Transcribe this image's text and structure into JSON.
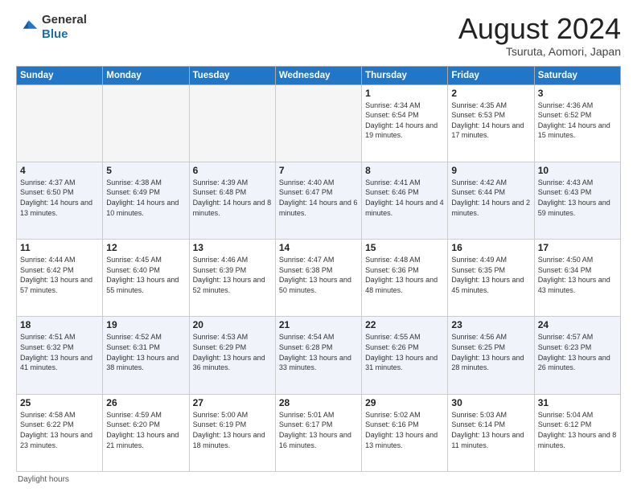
{
  "header": {
    "logo_line1": "General",
    "logo_line2": "Blue",
    "month_title": "August 2024",
    "location": "Tsuruta, Aomori, Japan"
  },
  "calendar": {
    "days_of_week": [
      "Sunday",
      "Monday",
      "Tuesday",
      "Wednesday",
      "Thursday",
      "Friday",
      "Saturday"
    ],
    "footer_label": "Daylight hours"
  },
  "weeks": [
    [
      {
        "day": "",
        "info": ""
      },
      {
        "day": "",
        "info": ""
      },
      {
        "day": "",
        "info": ""
      },
      {
        "day": "",
        "info": ""
      },
      {
        "day": "1",
        "info": "Sunrise: 4:34 AM\nSunset: 6:54 PM\nDaylight: 14 hours\nand 19 minutes."
      },
      {
        "day": "2",
        "info": "Sunrise: 4:35 AM\nSunset: 6:53 PM\nDaylight: 14 hours\nand 17 minutes."
      },
      {
        "day": "3",
        "info": "Sunrise: 4:36 AM\nSunset: 6:52 PM\nDaylight: 14 hours\nand 15 minutes."
      }
    ],
    [
      {
        "day": "4",
        "info": "Sunrise: 4:37 AM\nSunset: 6:50 PM\nDaylight: 14 hours\nand 13 minutes."
      },
      {
        "day": "5",
        "info": "Sunrise: 4:38 AM\nSunset: 6:49 PM\nDaylight: 14 hours\nand 10 minutes."
      },
      {
        "day": "6",
        "info": "Sunrise: 4:39 AM\nSunset: 6:48 PM\nDaylight: 14 hours\nand 8 minutes."
      },
      {
        "day": "7",
        "info": "Sunrise: 4:40 AM\nSunset: 6:47 PM\nDaylight: 14 hours\nand 6 minutes."
      },
      {
        "day": "8",
        "info": "Sunrise: 4:41 AM\nSunset: 6:46 PM\nDaylight: 14 hours\nand 4 minutes."
      },
      {
        "day": "9",
        "info": "Sunrise: 4:42 AM\nSunset: 6:44 PM\nDaylight: 14 hours\nand 2 minutes."
      },
      {
        "day": "10",
        "info": "Sunrise: 4:43 AM\nSunset: 6:43 PM\nDaylight: 13 hours\nand 59 minutes."
      }
    ],
    [
      {
        "day": "11",
        "info": "Sunrise: 4:44 AM\nSunset: 6:42 PM\nDaylight: 13 hours\nand 57 minutes."
      },
      {
        "day": "12",
        "info": "Sunrise: 4:45 AM\nSunset: 6:40 PM\nDaylight: 13 hours\nand 55 minutes."
      },
      {
        "day": "13",
        "info": "Sunrise: 4:46 AM\nSunset: 6:39 PM\nDaylight: 13 hours\nand 52 minutes."
      },
      {
        "day": "14",
        "info": "Sunrise: 4:47 AM\nSunset: 6:38 PM\nDaylight: 13 hours\nand 50 minutes."
      },
      {
        "day": "15",
        "info": "Sunrise: 4:48 AM\nSunset: 6:36 PM\nDaylight: 13 hours\nand 48 minutes."
      },
      {
        "day": "16",
        "info": "Sunrise: 4:49 AM\nSunset: 6:35 PM\nDaylight: 13 hours\nand 45 minutes."
      },
      {
        "day": "17",
        "info": "Sunrise: 4:50 AM\nSunset: 6:34 PM\nDaylight: 13 hours\nand 43 minutes."
      }
    ],
    [
      {
        "day": "18",
        "info": "Sunrise: 4:51 AM\nSunset: 6:32 PM\nDaylight: 13 hours\nand 41 minutes."
      },
      {
        "day": "19",
        "info": "Sunrise: 4:52 AM\nSunset: 6:31 PM\nDaylight: 13 hours\nand 38 minutes."
      },
      {
        "day": "20",
        "info": "Sunrise: 4:53 AM\nSunset: 6:29 PM\nDaylight: 13 hours\nand 36 minutes."
      },
      {
        "day": "21",
        "info": "Sunrise: 4:54 AM\nSunset: 6:28 PM\nDaylight: 13 hours\nand 33 minutes."
      },
      {
        "day": "22",
        "info": "Sunrise: 4:55 AM\nSunset: 6:26 PM\nDaylight: 13 hours\nand 31 minutes."
      },
      {
        "day": "23",
        "info": "Sunrise: 4:56 AM\nSunset: 6:25 PM\nDaylight: 13 hours\nand 28 minutes."
      },
      {
        "day": "24",
        "info": "Sunrise: 4:57 AM\nSunset: 6:23 PM\nDaylight: 13 hours\nand 26 minutes."
      }
    ],
    [
      {
        "day": "25",
        "info": "Sunrise: 4:58 AM\nSunset: 6:22 PM\nDaylight: 13 hours\nand 23 minutes."
      },
      {
        "day": "26",
        "info": "Sunrise: 4:59 AM\nSunset: 6:20 PM\nDaylight: 13 hours\nand 21 minutes."
      },
      {
        "day": "27",
        "info": "Sunrise: 5:00 AM\nSunset: 6:19 PM\nDaylight: 13 hours\nand 18 minutes."
      },
      {
        "day": "28",
        "info": "Sunrise: 5:01 AM\nSunset: 6:17 PM\nDaylight: 13 hours\nand 16 minutes."
      },
      {
        "day": "29",
        "info": "Sunrise: 5:02 AM\nSunset: 6:16 PM\nDaylight: 13 hours\nand 13 minutes."
      },
      {
        "day": "30",
        "info": "Sunrise: 5:03 AM\nSunset: 6:14 PM\nDaylight: 13 hours\nand 11 minutes."
      },
      {
        "day": "31",
        "info": "Sunrise: 5:04 AM\nSunset: 6:12 PM\nDaylight: 13 hours\nand 8 minutes."
      }
    ]
  ]
}
